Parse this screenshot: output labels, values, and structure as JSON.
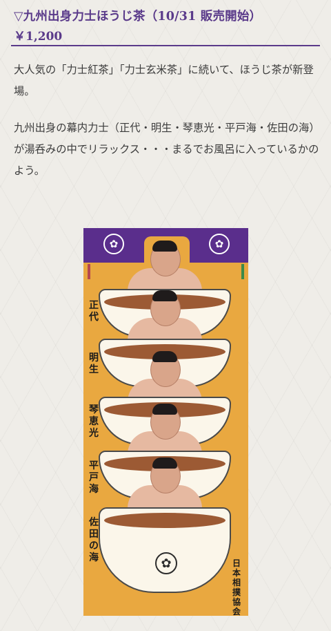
{
  "product": {
    "title": "▽九州出身力士ほうじ茶（10/31 販売開始）",
    "price": "￥1,200"
  },
  "description": {
    "paragraph1": "大人気の「力士紅茶」「力士玄米茶」に続いて、ほうじ茶が新登場。",
    "paragraph2": "九州出身の幕内力士（正代・明生・琴恵光・平戸海・佐田の海）が湯呑みの中でリラックス・・・まるでお風呂に入っているかのよう。"
  },
  "poster": {
    "wrestlers": [
      "正代",
      "明生",
      "琴恵光",
      "平戸海",
      "佐田の海"
    ],
    "association": "日本相撲協会",
    "crest_icon": "sakura-crest-icon",
    "colors": {
      "band": "#5a2e8c",
      "background": "#e9a840"
    }
  }
}
